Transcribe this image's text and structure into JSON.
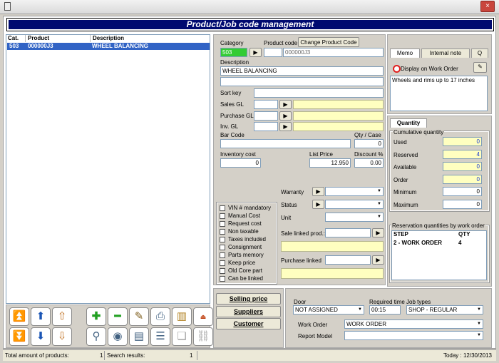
{
  "window": {
    "title": "Product/Job code management",
    "close_glyph": "×"
  },
  "list": {
    "columns": [
      "Cat.",
      "Product",
      "Description"
    ],
    "rows": [
      {
        "cat": "503",
        "product": "000000J3",
        "description": "WHEEL BALANCING"
      }
    ]
  },
  "form": {
    "category_label": "Category",
    "category_value": "503",
    "product_code_label": "Product code",
    "product_code_value": "000000J3",
    "change_code_button": "Change Product Code",
    "description_label": "Description",
    "description_value": "WHEEL BALANCING",
    "sort_key_label": "Sort key",
    "sales_gl_label": "Sales GL",
    "purchase_gl_label": "Purchase GL",
    "inv_gl_label": "Inv. GL",
    "bar_code_label": "Bar Code",
    "qty_case_label": "Qty / Case",
    "qty_case_value": "0",
    "inventory_cost_label": "Inventory cost",
    "inventory_cost_value": "0",
    "list_price_label": "List Price",
    "list_price_value": "12.950",
    "discount_label": "Discount %",
    "discount_value": "0.00",
    "warranty_label": "Warranty",
    "status_label": "Status",
    "unit_label": "Unit",
    "sale_linked_label": "Sale linked prod.:",
    "purchase_linked_label": "Purchase linked"
  },
  "checkboxes": [
    "VIN # mandatory",
    "Manual Cost",
    "Request cost",
    "Non taxable",
    "Taxes included",
    "Consignment",
    "Parts memory",
    "Keep price",
    "Old Core part",
    "Can be linked"
  ],
  "memo": {
    "tabs": [
      "Memo",
      "Internal note",
      "Q"
    ],
    "display_label": "Display on Work Order",
    "text": "Wheels and rims up to 17 inches"
  },
  "quantity": {
    "tab": "Quantity",
    "group": "Cumulative quantity",
    "rows": [
      {
        "label": "Used",
        "value": "0"
      },
      {
        "label": "Reserved",
        "value": "4"
      },
      {
        "label": "Available",
        "value": "0"
      },
      {
        "label": "Order",
        "value": "0"
      },
      {
        "label": "Minimum",
        "value": "0"
      },
      {
        "label": "Maximum",
        "value": "0"
      }
    ]
  },
  "reservation": {
    "group": "Reservation quantities by work order",
    "col_step": "STEP",
    "col_qty": "QTY",
    "rows": [
      {
        "step": "2 - WORK ORDER",
        "qty": "4"
      }
    ]
  },
  "side_buttons": {
    "selling_price": "Selling price",
    "suppliers": "Suppliers",
    "customer": "Customer"
  },
  "work": {
    "door_label": "Door",
    "door_value": "NOT ASSIGNED",
    "required_time_label": "Required time",
    "required_time_value": "00:15",
    "job_types_label": "Job types",
    "job_types_value": "SHOP - REGULAR",
    "work_order_label": "Work Order",
    "work_order_value": "WORK ORDER",
    "report_model_label": "Report Model"
  },
  "statusbar": {
    "total_label": "Total amount of products:",
    "total_value": "1",
    "search_label": "Search results:",
    "search_value": "1",
    "today": "Today : 12/30/2013"
  },
  "colors": {
    "banner": "#000a70",
    "selected_row": "#3163c5",
    "category_fill": "#33cc33",
    "yellow_field": "#ffffc0"
  }
}
